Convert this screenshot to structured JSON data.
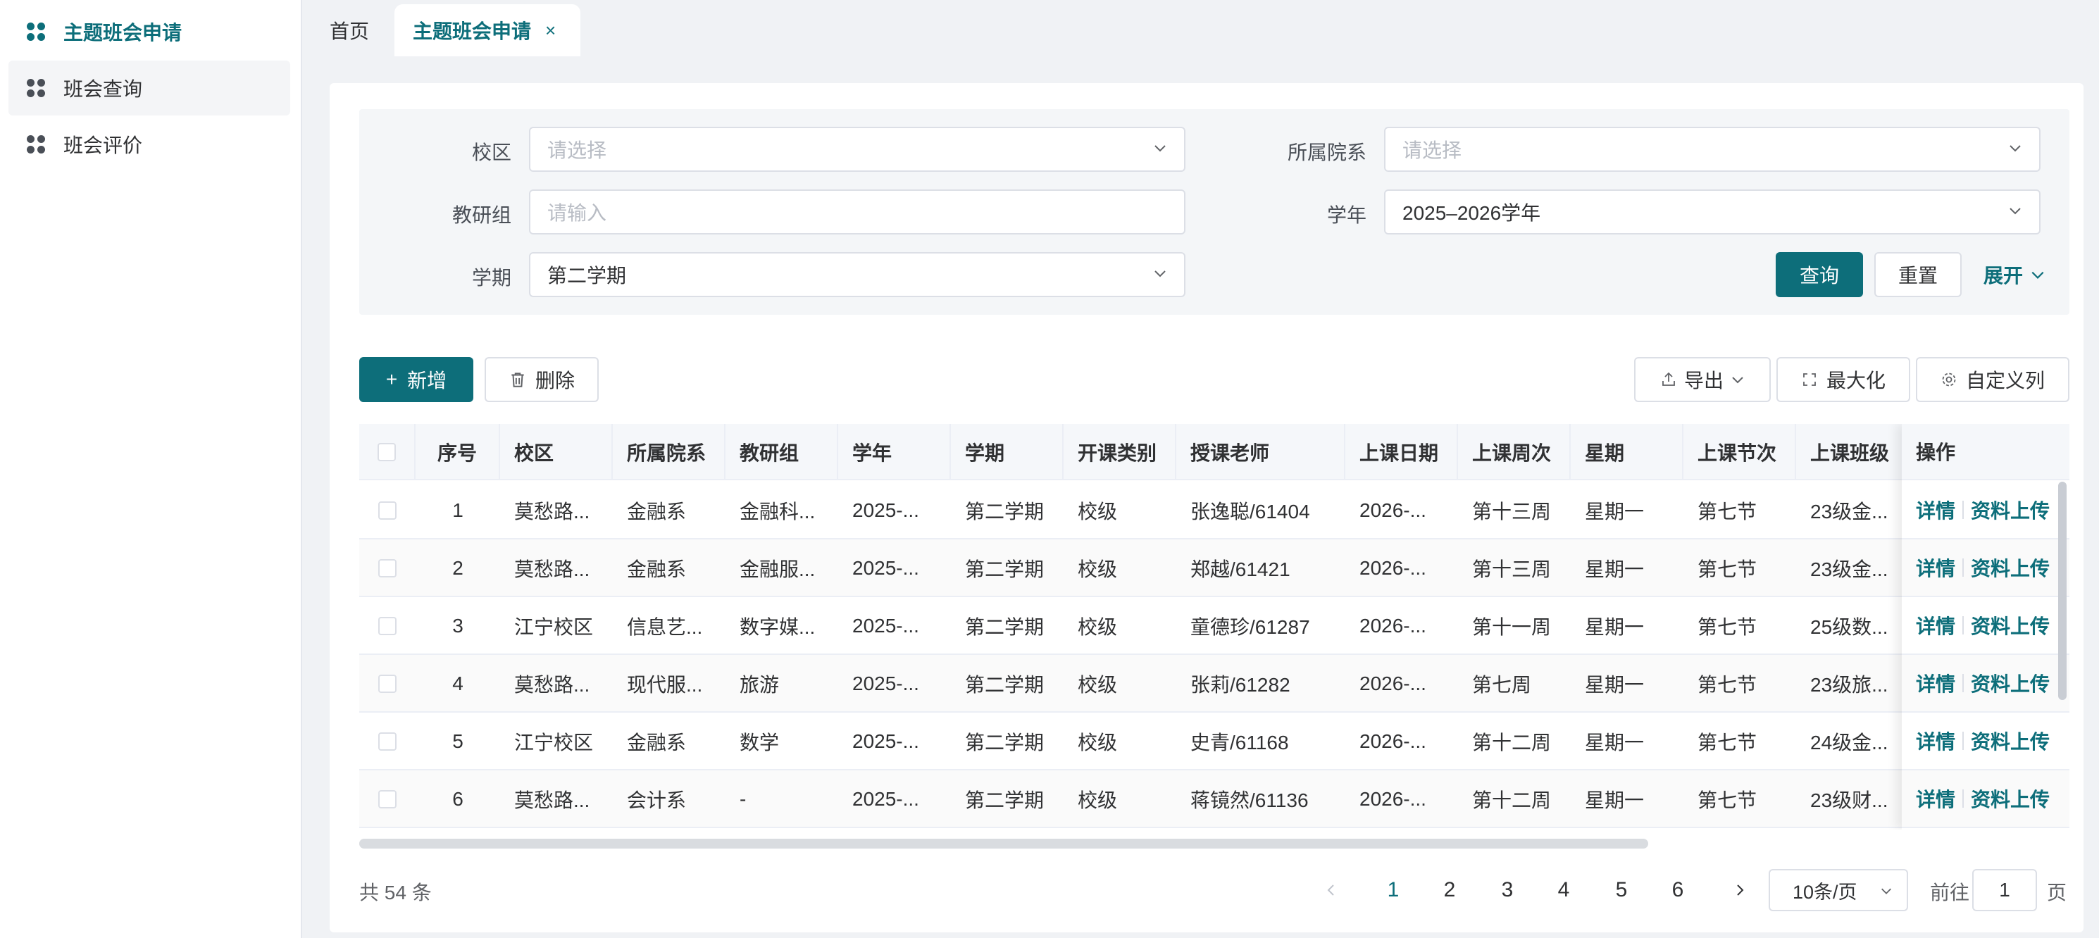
{
  "sidebar": {
    "items": [
      {
        "label": "主题班会申请"
      },
      {
        "label": "班会查询"
      },
      {
        "label": "班会评价"
      }
    ]
  },
  "tabs": {
    "home": "首页",
    "current": "主题班会申请",
    "close": "×"
  },
  "filters": {
    "campus": {
      "label": "校区",
      "placeholder": "请选择"
    },
    "department": {
      "label": "所属院系",
      "placeholder": "请选择"
    },
    "group": {
      "label": "教研组",
      "placeholder": "请输入"
    },
    "year": {
      "label": "学年",
      "value": "2025–2026学年"
    },
    "term": {
      "label": "学期",
      "value": "第二学期"
    },
    "search_label": "查询",
    "reset_label": "重置",
    "expand_label": "展开"
  },
  "toolbar": {
    "add_label": "新增",
    "delete_label": "删除",
    "export_label": "导出",
    "maximize_label": "最大化",
    "custom_columns_label": "自定义列"
  },
  "table": {
    "columns": [
      "序号",
      "校区",
      "所属院系",
      "教研组",
      "学年",
      "学期",
      "开课类别",
      "授课老师",
      "上课日期",
      "上课周次",
      "星期",
      "上课节次",
      "上课班级",
      "操作"
    ],
    "rows": [
      [
        "1",
        "莫愁路...",
        "金融系",
        "金融科...",
        "2025-...",
        "第二学期",
        "校级",
        "张逸聪/61404",
        "2026-...",
        "第十三周",
        "星期一",
        "第七节",
        "23级金..."
      ],
      [
        "2",
        "莫愁路...",
        "金融系",
        "金融服...",
        "2025-...",
        "第二学期",
        "校级",
        "郑越/61421",
        "2026-...",
        "第十三周",
        "星期一",
        "第七节",
        "23级金..."
      ],
      [
        "3",
        "江宁校区",
        "信息艺...",
        "数字媒...",
        "2025-...",
        "第二学期",
        "校级",
        "童德珍/61287",
        "2026-...",
        "第十一周",
        "星期一",
        "第七节",
        "25级数..."
      ],
      [
        "4",
        "莫愁路...",
        "现代服...",
        "旅游",
        "2025-...",
        "第二学期",
        "校级",
        "张莉/61282",
        "2026-...",
        "第七周",
        "星期一",
        "第七节",
        "23级旅..."
      ],
      [
        "5",
        "江宁校区",
        "金融系",
        "数学",
        "2025-...",
        "第二学期",
        "校级",
        "史青/61168",
        "2026-...",
        "第十二周",
        "星期一",
        "第七节",
        "24级金..."
      ],
      [
        "6",
        "莫愁路...",
        "会计系",
        "-",
        "2025-...",
        "第二学期",
        "校级",
        "蒋镜然/61136",
        "2026-...",
        "第十二周",
        "星期一",
        "第七节",
        "23级财..."
      ]
    ],
    "actions": {
      "detail": "详情",
      "upload": "资料上传"
    }
  },
  "pagination": {
    "total_text": "共 54 条",
    "pages": [
      "1",
      "2",
      "3",
      "4",
      "5",
      "6"
    ],
    "current_page": "1",
    "page_size": "10条/页",
    "goto_prefix": "前往",
    "goto_value": "1",
    "goto_suffix": "页"
  },
  "colors": {
    "accent": "#0d6e7a"
  }
}
